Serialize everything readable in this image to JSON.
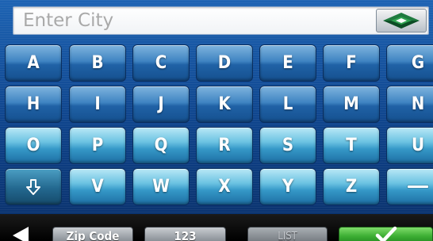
{
  "search": {
    "placeholder": "Enter City",
    "value": ""
  },
  "keyboard": {
    "row1": [
      "A",
      "B",
      "C",
      "D",
      "E",
      "F",
      "G"
    ],
    "row2": [
      "H",
      "I",
      "J",
      "K",
      "L",
      "M",
      "N"
    ],
    "row3": [
      "O",
      "P",
      "Q",
      "R",
      "S",
      "T",
      "U"
    ],
    "row4": [
      "V",
      "W",
      "X",
      "Y",
      "Z"
    ],
    "shift_icon": "down-arrow-icon",
    "space_icon": "space-icon"
  },
  "bottom_bar": {
    "back_icon": "back-arrow-icon",
    "zip_code_label": "Zip Code",
    "numbers_label": "123",
    "list_label": "LIST",
    "ok_icon": "checkmark-icon"
  },
  "colors": {
    "key_blue": "#2062a6",
    "key_light": "#6cc3e2",
    "ok_green": "#3cae34"
  }
}
